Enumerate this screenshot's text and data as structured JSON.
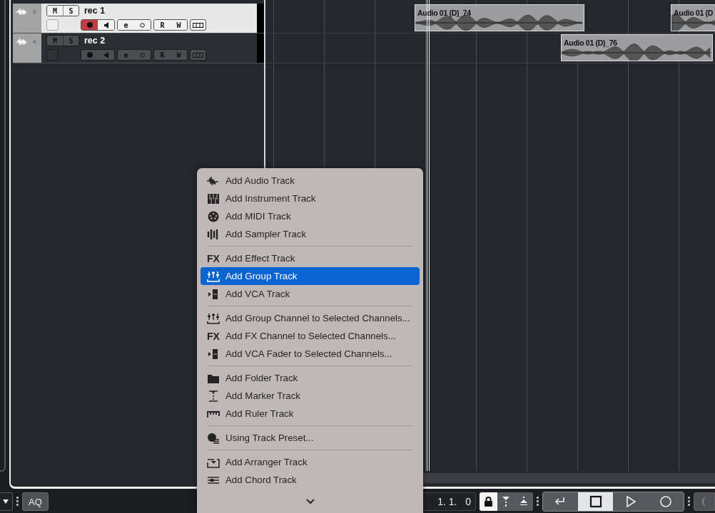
{
  "tracks": [
    {
      "number": "3",
      "name": "rec 1",
      "selected": true,
      "record_armed": true,
      "mute": "M",
      "solo": "S",
      "edit": "e",
      "read": "R",
      "write": "W",
      "events": [
        {
          "name": "Audio 01 (D)_74"
        },
        {
          "name": "Audio 01 (D"
        }
      ]
    },
    {
      "number": "4",
      "name": "rec 2",
      "selected": false,
      "record_armed": false,
      "mute": "M",
      "solo": "S",
      "edit": "e",
      "read": "R",
      "write": "W",
      "events": [
        {
          "name": "Audio 01 (D)_76"
        }
      ]
    }
  ],
  "add_track_menu": {
    "items": [
      {
        "kind": "item",
        "label": "Add Audio Track",
        "selected": false
      },
      {
        "kind": "item",
        "label": "Add Instrument Track",
        "selected": false
      },
      {
        "kind": "item",
        "label": "Add MIDI Track",
        "selected": false
      },
      {
        "kind": "item",
        "label": "Add Sampler Track",
        "selected": false
      },
      {
        "kind": "separator"
      },
      {
        "kind": "item",
        "label": "Add Effect Track",
        "selected": false,
        "badge": "FX"
      },
      {
        "kind": "item",
        "label": "Add Group Track",
        "selected": true
      },
      {
        "kind": "item",
        "label": "Add VCA Track",
        "selected": false
      },
      {
        "kind": "separator"
      },
      {
        "kind": "item",
        "label": "Add Group Channel to Selected Channels...",
        "selected": false
      },
      {
        "kind": "item",
        "label": "Add FX Channel to Selected Channels...",
        "selected": false,
        "badge": "FX"
      },
      {
        "kind": "item",
        "label": "Add VCA Fader to Selected Channels...",
        "selected": false
      },
      {
        "kind": "separator"
      },
      {
        "kind": "item",
        "label": "Add Folder Track",
        "selected": false
      },
      {
        "kind": "item",
        "label": "Add Marker Track",
        "selected": false
      },
      {
        "kind": "item",
        "label": "Add Ruler Track",
        "selected": false
      },
      {
        "kind": "separator"
      },
      {
        "kind": "item",
        "label": "Using Track Preset...",
        "selected": false
      },
      {
        "kind": "separator"
      },
      {
        "kind": "item",
        "label": "Add Arranger Track",
        "selected": false
      },
      {
        "kind": "item",
        "label": "Add Chord Track",
        "selected": false
      }
    ]
  },
  "toolbar": {
    "quantize": "AQ",
    "position": "1. 1.   0",
    "snap_lock": {
      "selected": true
    },
    "transport": [
      {
        "kind": "cycle",
        "selected": false
      },
      {
        "kind": "stop",
        "selected": true
      },
      {
        "kind": "play",
        "selected": false
      },
      {
        "kind": "record",
        "selected": false
      }
    ]
  }
}
